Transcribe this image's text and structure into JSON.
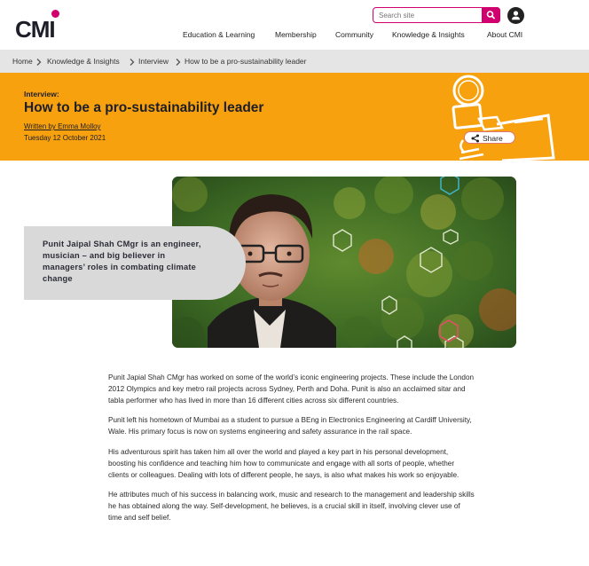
{
  "site": {
    "logo_text": "CMI",
    "search_placeholder": "Search site",
    "nav": [
      "Education & Learning",
      "Membership",
      "Community",
      "Knowledge & Insights",
      "About CMI"
    ]
  },
  "breadcrumb": [
    "Home",
    "Knowledge & Insights",
    "Interview",
    "How to be a pro-sustainability leader"
  ],
  "article": {
    "kicker": "Interview:",
    "title": "How to be a pro-sustainability leader",
    "author": "Written by Emma Molloy",
    "date": "Tuesday 12 October 2021",
    "share_label": "Share",
    "pull_quote": "Punit Jaipal Shah CMgr is an engineer, musician – and big believer in managers’ roles in combating climate change",
    "paragraphs": [
      "Punit Japial Shah CMgr has worked on some of the world’s iconic engineering projects. These include the London 2012 Olympics and key metro rail projects across Sydney, Perth and Doha. Punit is also an acclaimed sitar and tabla performer who has lived in more than 16 different cities across six different countries.",
      "Punit left his hometown of Mumbai as a student to pursue a BEng in Electronics Engineering at Cardiff University, Wale. His primary focus is now on systems engineering and safety assurance in the rail space.",
      "His adventurous spirit has taken him all over the world and played a key part in his personal development, boosting his confidence and teaching him how to communicate and engage with all sorts of people, whether clients or colleagues. Dealing with lots of different people, he says, is also what makes his work so enjoyable.",
      "He attributes much of his success in balancing work, music and research to the management and leadership skills he has obtained along the way. Self-development, he believes, is a crucial skill in itself, involving clever use of time and self belief."
    ]
  },
  "colors": {
    "brand_magenta": "#d0006f",
    "banner_orange": "#f7a10e",
    "breadcrumb_bg": "#e5e5e5",
    "quote_bg": "#d9d9d9"
  },
  "icons": [
    "search-icon",
    "user-icon",
    "chevron-right-icon",
    "share-icon",
    "magnifier-illustration"
  ]
}
